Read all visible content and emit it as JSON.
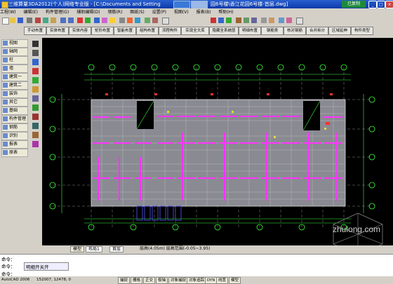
{
  "window": {
    "title": "三维算量3DA2012(个人)网络专业版 - [C:\\Documents and Setting",
    "title_tail": "园6号楼\\香江花园6号楼-首层.dwg]",
    "badge": "已复制"
  },
  "menu": [
    "工程(W)",
    "编辑(E)",
    "构件管理(G)",
    "辅助编辑(D)",
    "钢筋(R)",
    "图纸(S)",
    "设置(P)",
    "视图(V)",
    "报表(B)",
    "帮助(H)"
  ],
  "command_buttons": [
    "手动布置",
    "实体布置",
    "实体内容",
    "矩形布置",
    "智能布置",
    "组构布置",
    "流程构件",
    "实现全文库",
    "隐藏全系统层",
    "明细布置",
    "钢筋类",
    "核对钢筋",
    "合并拆分",
    "区域延伸",
    "构件类型"
  ],
  "left_panel": [
    "视图",
    "轴网",
    "柱",
    "墙",
    "建筑一",
    "建筑二",
    "装饰",
    "其它",
    "基础",
    "构件管理",
    "钢筋",
    "识别",
    "报表",
    "原表"
  ],
  "tabs": [
    "模型",
    "布局1",
    "首层",
    "层高(4.05m) 层高范围(-0.05~3.95)"
  ],
  "command_lines": [
    "命令：",
    "命令：",
    "命令："
  ],
  "command_text": "明细开关开",
  "status": {
    "app": "AutoCAD 2006",
    "coords": "152007, 12478, 0",
    "toggles": [
      "捕捉",
      "栅格",
      "正交",
      "极轴",
      "对象捕捉",
      "对象追踪",
      "DYN",
      "线宽",
      "模型"
    ],
    "watermark": "zhulong.com"
  }
}
